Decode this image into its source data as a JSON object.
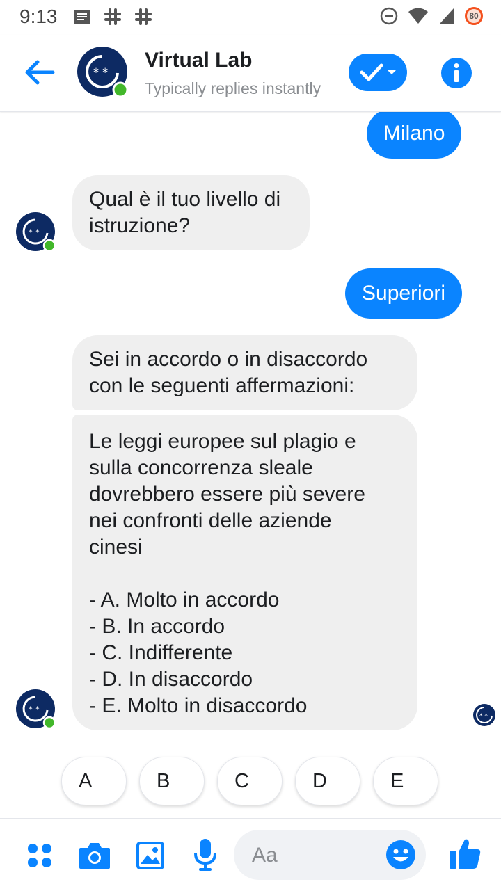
{
  "status_bar": {
    "time": "9:13",
    "battery_badge": "80"
  },
  "header": {
    "title": "Virtual Lab",
    "subtitle": "Typically replies instantly",
    "accent": "#0a84ff"
  },
  "messages": [
    {
      "from": "user",
      "text": "Milano"
    },
    {
      "from": "bot",
      "text": "Qual è il tuo livello di\nistruzione?"
    },
    {
      "from": "user",
      "text": "Superiori"
    },
    {
      "from": "bot",
      "text": "Sei in accordo o in disaccordo\ncon le seguenti affermazioni:"
    },
    {
      "from": "bot",
      "text": "Le leggi europee sul plagio e\nsulla concorrenza sleale\ndovrebbero essere più severe\nnei confronti delle aziende\ncinesi\n\n- A. Molto in accordo\n- B. In accordo\n- C. Indifferente\n- D. In disaccordo\n- E. Molto in disaccordo"
    }
  ],
  "quick_replies": [
    "A",
    "B",
    "C",
    "D",
    "E"
  ],
  "composer": {
    "placeholder": "Aa"
  },
  "icons": [
    "back-arrow-icon",
    "check-icon",
    "info-icon",
    "apps-icon",
    "camera-icon",
    "image-icon",
    "mic-icon",
    "emoji-icon",
    "thumbs-up-icon"
  ]
}
